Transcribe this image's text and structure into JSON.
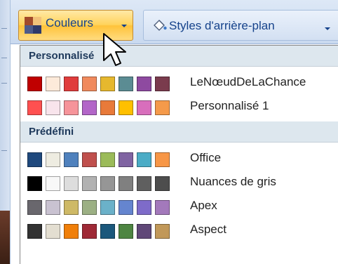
{
  "toolbar": {
    "colors_button": {
      "label": "Couleurs",
      "icon": "theme-colors-icon",
      "icon_colors": [
        "#a24a2a",
        "#f2c27a",
        "#4e5b8a",
        "#2f3a6a"
      ]
    },
    "background_styles_button": {
      "label": "Styles d'arrière-plan",
      "icon": "background-styles-icon"
    }
  },
  "menu": {
    "sections": [
      {
        "title": "Personnalisé",
        "items": [
          {
            "name": "LeNœudDeLaChance",
            "colors": [
              "#c00000",
              "#fdeada",
              "#e03c3c",
              "#f08a5d",
              "#e6b82e",
              "#5b8c93",
              "#8e4aa0",
              "#7a3b4d"
            ]
          },
          {
            "name": "Personnalisé 1",
            "colors": [
              "#ff5050",
              "#f8e4ec",
              "#f6949a",
              "#b366c8",
              "#e87a3a",
              "#ffc000",
              "#d86ebc",
              "#f59a4a"
            ]
          }
        ]
      },
      {
        "title": "Prédéfini",
        "items": [
          {
            "name": "Office",
            "colors": [
              "#1f497d",
              "#eeece1",
              "#4f81bd",
              "#c0504d",
              "#9bbb59",
              "#8064a2",
              "#4bacc6",
              "#f79646"
            ]
          },
          {
            "name": "Nuances de gris",
            "colors": [
              "#000000",
              "#f8f8f8",
              "#dddddd",
              "#b2b2b2",
              "#969696",
              "#808080",
              "#5f5f5f",
              "#4d4d4d"
            ]
          },
          {
            "name": "Apex",
            "colors": [
              "#69676d",
              "#c9c2d1",
              "#ceb966",
              "#9cb084",
              "#6bb1c9",
              "#6585cf",
              "#7e6bc9",
              "#a379bb"
            ]
          },
          {
            "name": "Aspect",
            "colors": [
              "#323232",
              "#e3ded1",
              "#f07f09",
              "#9f2936",
              "#1b587c",
              "#4e8542",
              "#604878",
              "#c19859"
            ]
          }
        ]
      }
    ]
  }
}
